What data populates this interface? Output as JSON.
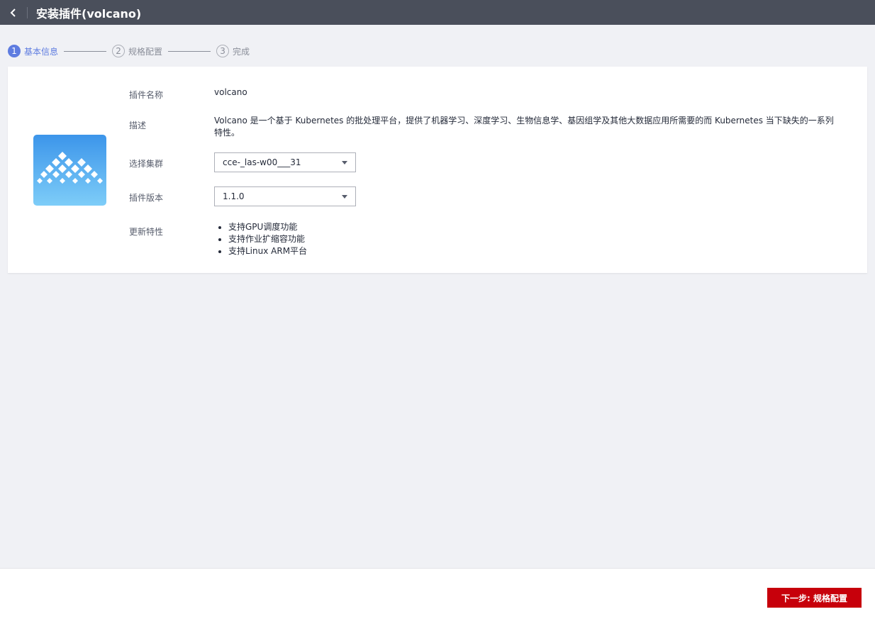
{
  "header": {
    "title": "安装插件(volcano)",
    "back_icon": "chevron-left-icon"
  },
  "steps": [
    {
      "num": "1",
      "label": "基本信息",
      "state": "active"
    },
    {
      "num": "2",
      "label": "规格配置",
      "state": "todo"
    },
    {
      "num": "3",
      "label": "完成",
      "state": "todo"
    }
  ],
  "form": {
    "name_label": "插件名称",
    "name_value": "volcano",
    "desc_label": "描述",
    "desc_value": "Volcano 是一个基于 Kubernetes 的批处理平台，提供了机器学习、深度学习、生物信息学、基因组学及其他大数据应用所需要的而 Kubernetes 当下缺失的一系列特性。",
    "cluster_label": "选择集群",
    "cluster_value": "cce-_las-w00___31",
    "version_label": "插件版本",
    "version_value": "1.1.0",
    "features_label": "更新特性",
    "features": [
      "支持GPU调度功能",
      "支持作业扩缩容功能",
      "支持Linux ARM平台"
    ]
  },
  "footer": {
    "next_label": "下一步: 规格配置"
  },
  "colors": {
    "accent": "#5e7ce0",
    "primary_button": "#c7000b",
    "topbar": "#4a4f5b"
  }
}
